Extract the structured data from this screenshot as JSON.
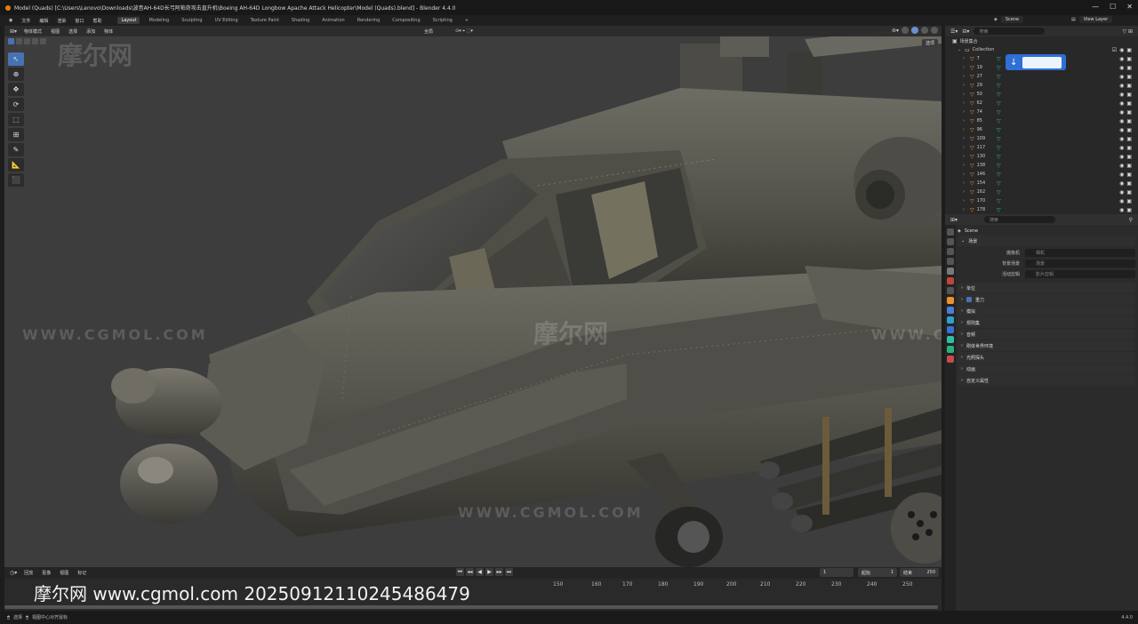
{
  "window": {
    "title": "Model (Quads) [C:\\Users\\Lenovo\\Downloads\\波音AH-64D长弓阿帕奇攻击直升机\\Boeing AH-64D Longbow Apache Attack Helicopter\\Model (Quads).blend] - Blender 4.4.0"
  },
  "menus": [
    "文件",
    "编辑",
    "渲染",
    "窗口",
    "帮助"
  ],
  "workspaces": [
    "Layout",
    "Modeling",
    "Sculpting",
    "UV Editing",
    "Texture Paint",
    "Shading",
    "Animation",
    "Rendering",
    "Compositing",
    "Scripting",
    "+"
  ],
  "top_right": {
    "scene": "Scene",
    "view_layer": "View Layer"
  },
  "viewport": {
    "mode": "物体模式",
    "menus": [
      "视图",
      "选择",
      "添加",
      "物体"
    ],
    "transform": "全局",
    "select_label": "选项"
  },
  "tools": [
    "↖",
    "⊕",
    "✥",
    "⟳",
    "⬚",
    "⊞",
    "✎",
    "📐",
    "⬛"
  ],
  "watermarks": {
    "cn": "摩尔网",
    "url": "WWW.CGMOL.COM",
    "bottom": "摩尔网 www.cgmol.com 20250912110245486479"
  },
  "timeline": {
    "menus": [
      "回放",
      "抠像",
      "视图",
      "标记"
    ],
    "ticks": [
      "150",
      "160",
      "170",
      "180",
      "190",
      "200",
      "210",
      "220",
      "230",
      "240",
      "250"
    ],
    "current_frame": "1",
    "start_label": "起始",
    "start": "1",
    "end_label": "结束",
    "end": "250"
  },
  "status": {
    "left": "选择",
    "hint": "视图中心对齐鼠标",
    "version": "4.4.0"
  },
  "outliner": {
    "search_placeholder": "搜索",
    "scene_collection": "场景集合",
    "collection": "Collection",
    "items": [
      "7",
      "19",
      "27",
      "29",
      "50",
      "62",
      "74",
      "85",
      "96",
      "109",
      "117",
      "130",
      "138",
      "146",
      "154",
      "162",
      "170",
      "178"
    ]
  },
  "properties": {
    "search_placeholder": "搜索",
    "scene": "Scene",
    "section_scene": "场景",
    "camera_label": "摄像机",
    "camera_val": "相机",
    "bg_scene_label": "背景场景",
    "bg_scene_val": "场景",
    "active_clip_label": "活动剪辑",
    "active_clip_val": "影片剪辑",
    "panels": [
      "单位",
      "重力",
      "模拟",
      "规则集",
      "音频",
      "刚体世界环境",
      "光照探头",
      "动画",
      "自定义属性"
    ]
  }
}
